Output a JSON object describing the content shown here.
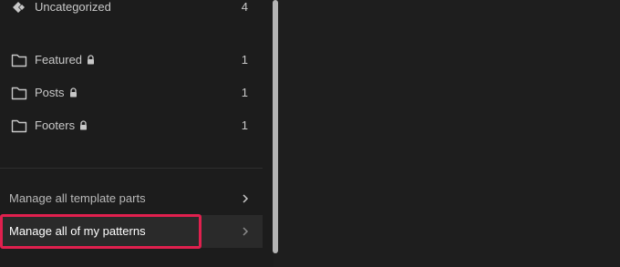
{
  "sidebar": {
    "categories": [
      {
        "label": "Uncategorized",
        "count": "4",
        "locked": false,
        "icon": "diamond-icon"
      },
      {
        "label": "Featured",
        "count": "1",
        "locked": true,
        "icon": "folder-icon"
      },
      {
        "label": "Posts",
        "count": "1",
        "locked": true,
        "icon": "folder-icon"
      },
      {
        "label": "Footers",
        "count": "1",
        "locked": true,
        "icon": "folder-icon"
      }
    ],
    "links": [
      {
        "label": "Manage all template parts",
        "icon": "chevron-right-icon"
      },
      {
        "label": "Manage all of my patterns",
        "icon": "chevron-right-icon",
        "selected": true
      }
    ]
  },
  "colors": {
    "background": "#1e1e1e",
    "highlight": "#e0204e",
    "text": "#c8c8c8"
  }
}
